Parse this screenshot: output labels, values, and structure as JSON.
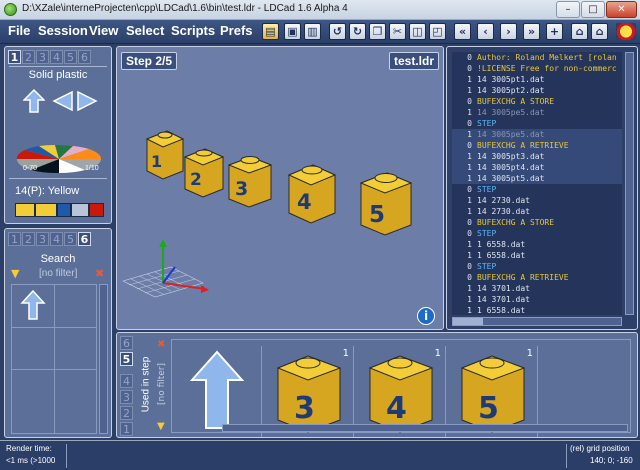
{
  "window": {
    "title": "D:\\XZale\\interneProjecten\\cpp\\LDCad\\1.6\\bin\\test.ldr - LDCad 1.6 Alpha 4",
    "minimize": "–",
    "maximize": "□",
    "close": "✕"
  },
  "menu": [
    "File",
    "Session",
    "View",
    "Select",
    "Scripts",
    "Prefs"
  ],
  "toolbar_icons": [
    "open-file-icon",
    "save-icon",
    "save-all-icon",
    "undo-icon",
    "redo-icon",
    "copy-icon",
    "cut-icon",
    "paste-icon",
    "paste-special-icon",
    "step-first-icon",
    "step-prev-icon",
    "step-next-icon",
    "step-last-icon",
    "step-add-icon",
    "home-icon",
    "home-alt-icon",
    "lego-logo-icon"
  ],
  "color_panel": {
    "tabs": [
      "1",
      "2",
      "3",
      "4",
      "5",
      "6"
    ],
    "active_tab": "1",
    "title": "Solid plastic",
    "range_left": "0-70",
    "range_right": "1/10",
    "selected_color": "14(P): Yellow",
    "swatches": [
      "#f2cd37",
      "#f2cd37",
      "#1e5aa8",
      "#b8c4d8",
      "#c91a09"
    ]
  },
  "parts_panel": {
    "tabs": [
      "1",
      "2",
      "3",
      "4",
      "5",
      "6"
    ],
    "active_tab": "6",
    "title": "Search",
    "filter": "[no filter]"
  },
  "viewport": {
    "step_label": "Step 2/5",
    "file_label": "test.ldr",
    "brick_numbers": [
      "1",
      "2",
      "3",
      "4",
      "5"
    ]
  },
  "source": {
    "lines": [
      {
        "n": "0",
        "text": "Author: Roland Melkert [rolan",
        "cls": "c1",
        "sel": false
      },
      {
        "n": "0",
        "text": "!LICENSE Free for non-commerc",
        "cls": "c1",
        "sel": false
      },
      {
        "n": "1",
        "text": "14  3005pt1.dat",
        "cls": "",
        "sel": false
      },
      {
        "n": "1",
        "text": "14  3005pt2.dat",
        "cls": "",
        "sel": false
      },
      {
        "n": "0",
        "text": "BUFEXCHG A STORE",
        "cls": "ckw",
        "sel": false
      },
      {
        "n": "1",
        "text": "14  3005pe5.dat",
        "cls": "cdim",
        "sel": false
      },
      {
        "n": "0",
        "text": "STEP",
        "cls": "cstep",
        "sel": false
      },
      {
        "n": "1",
        "text": "14  3005pe5.dat",
        "cls": "cdim",
        "sel": true
      },
      {
        "n": "0",
        "text": "BUFEXCHG A RETRIEVE",
        "cls": "ckw",
        "sel": true
      },
      {
        "n": "1",
        "text": "14  3005pt3.dat",
        "cls": "",
        "sel": true
      },
      {
        "n": "1",
        "text": "14  3005pt4.dat",
        "cls": "",
        "sel": true
      },
      {
        "n": "1",
        "text": "14  3005pt5.dat",
        "cls": "",
        "sel": true
      },
      {
        "n": "0",
        "text": "STEP",
        "cls": "cstep",
        "sel": false
      },
      {
        "n": "1",
        "text": "14  2730.dat",
        "cls": "",
        "sel": false
      },
      {
        "n": "1",
        "text": "14  2730.dat",
        "cls": "",
        "sel": false
      },
      {
        "n": "0",
        "text": "BUFEXCHG A STORE",
        "cls": "ckw",
        "sel": false
      },
      {
        "n": "0",
        "text": "STEP",
        "cls": "cstep",
        "sel": false
      },
      {
        "n": "1",
        "text": "1   6558.dat",
        "cls": "",
        "sel": false
      },
      {
        "n": "1",
        "text": "1   6558.dat",
        "cls": "",
        "sel": false
      },
      {
        "n": "0",
        "text": "STEP",
        "cls": "cstep",
        "sel": false
      },
      {
        "n": "0",
        "text": "BUFEXCHG A RETRIEVE",
        "cls": "ckw",
        "sel": false
      },
      {
        "n": "1",
        "text": "14  3701.dat",
        "cls": "",
        "sel": false
      },
      {
        "n": "1",
        "text": "14  3701.dat",
        "cls": "",
        "sel": false
      },
      {
        "n": "1",
        "text": "1   6558.dat",
        "cls": "",
        "sel": false
      }
    ]
  },
  "bin": {
    "tabs": [
      "1",
      "2",
      "3",
      "4",
      "5",
      "6"
    ],
    "active_tab": "5",
    "side_label": "Used in step",
    "filter": "[no filter]",
    "items": [
      {
        "number": "3",
        "count": "1"
      },
      {
        "number": "4",
        "count": "1"
      },
      {
        "number": "5",
        "count": "1"
      }
    ]
  },
  "status": {
    "render_label": "Render time:",
    "render_value": "<1 ms (>1000",
    "grid_label": "(rel) grid position",
    "grid_value": "140; 0; -160"
  }
}
